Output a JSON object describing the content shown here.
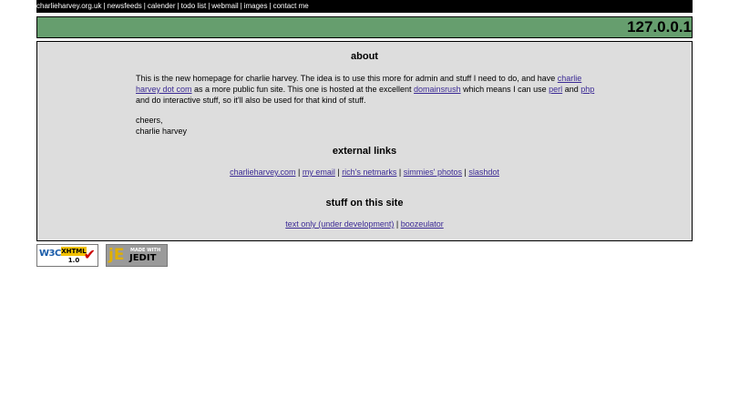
{
  "topnav": [
    {
      "label": "charlieharvey.org.uk"
    },
    {
      "label": "newsfeeds"
    },
    {
      "label": "calender"
    },
    {
      "label": "todo list"
    },
    {
      "label": "webmail"
    },
    {
      "label": "images"
    },
    {
      "label": "contact me"
    }
  ],
  "banner": {
    "ip": "127.0.0.1"
  },
  "about": {
    "heading": "about",
    "p1_a": "This is the new homepage for charlie harvey. The idea is to use this more for admin and stuff I need to do, and have",
    "link_chd": "charlie harvey dot com",
    "p1_b": "as a more public fun site. This one is hosted at the excellent",
    "link_domainsrush": "domainsrush",
    "p1_c": "which means I can use",
    "link_perl": "perl",
    "p1_and": "and",
    "link_php": "php",
    "p1_d": "and do interactive stuff, so it'll also be used for that kind of stuff.",
    "cheers": "cheers,",
    "signature": "charlie harvey"
  },
  "external": {
    "heading": "external links",
    "links": [
      "charlieharvey.com",
      "my email",
      "rich's netmarks",
      "simmies' photos",
      "slashdot"
    ]
  },
  "site": {
    "heading": "stuff on this site",
    "links": [
      "text only (under development)",
      "boozeulator"
    ]
  },
  "badges": {
    "w3c": {
      "w3c": "W3C",
      "label": "XHTML",
      "version": "1.0",
      "tick": "✔"
    },
    "jedit": {
      "logo": "jE",
      "made": "MADE WITH",
      "name": "JEDIT"
    }
  }
}
